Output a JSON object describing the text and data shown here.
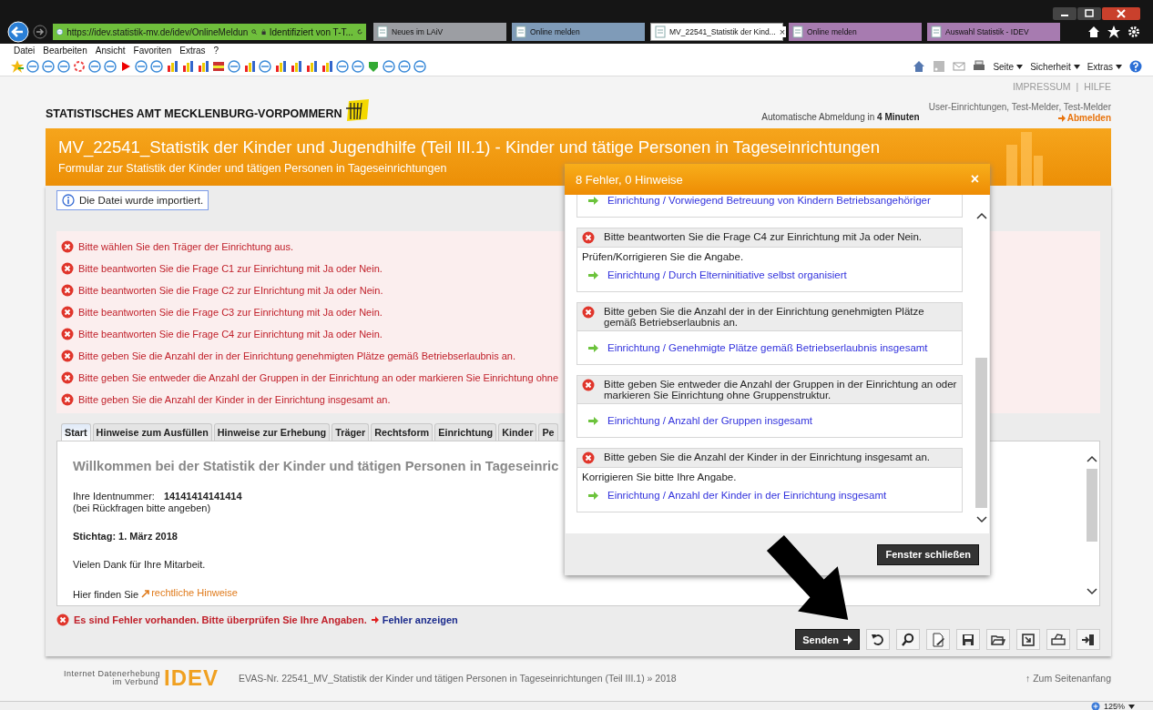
{
  "browser": {
    "url": "https://idev.statistik-mv.de/idev/OnlineMeldun",
    "identity": "Identifiziert von T-T...",
    "tabs": [
      {
        "label": "Neues im LAiV",
        "selected": false,
        "color": "#9c9ea3"
      },
      {
        "label": "Online melden",
        "selected": false,
        "color": "#7f9bb8"
      },
      {
        "label": "MV_22541_Statistik der Kind...",
        "selected": true,
        "color": "#ffffff"
      },
      {
        "label": "Online melden",
        "selected": false,
        "color": "#a77bb0"
      },
      {
        "label": "Auswahl Statistik - IDEV",
        "selected": false,
        "color": "#a77bb0"
      }
    ],
    "tab_close": "×",
    "menu": [
      "Datei",
      "Bearbeiten",
      "Ansicht",
      "Favoriten",
      "Extras",
      "?"
    ],
    "commands": [
      "Seite",
      "Sicherheit",
      "Extras"
    ],
    "zoom": "125%"
  },
  "header": {
    "links": [
      "IMPRESSUM",
      "HILFE"
    ],
    "link_separator": "|",
    "org": "STATISTISCHES AMT MECKLENBURG-VORPOMMERN",
    "session": "Automatische Abmeldung in **4 Minuten**",
    "user": "User-Einrichtungen, Test-Melder, Test-Melder",
    "logout": "Abmelden"
  },
  "banner": {
    "title": "MV_22541_Statistik der Kinder und Jugendhilfe (Teil III.1) - Kinder und tätige Personen in Tageseinrichtungen",
    "subtitle": "Formular zur Statistik der Kinder und tätigen Personen in Tageseinrichtungen"
  },
  "info": "Die Datei wurde importiert.",
  "errors": [
    "Bitte wählen Sie den Träger der Einrichtung aus.",
    "Bitte beantworten Sie die Frage C1 zur Einrichtung mit Ja oder Nein.",
    "Bitte beantworten Sie die Frage C2 zur EInrichtung mit Ja oder Nein.",
    "Bitte beantworten Sie die Frage C3 zur Einrichtung mit Ja oder Nein.",
    "Bitte beantworten Sie die Frage C4 zur Einrichtung mit Ja oder Nein.",
    "Bitte geben Sie die Anzahl der in der Einrichtung genehmigten Plätze gemäß Betriebserlaubnis an.",
    "Bitte geben Sie entweder die Anzahl der Gruppen in der Einrichtung an oder markieren Sie Einrichtung ohne",
    "Bitte geben Sie die Anzahl der Kinder in der Einrichtung insgesamt an."
  ],
  "form_tabs": [
    {
      "label": "Start",
      "selected": true
    },
    {
      "label": "Hinweise zum Ausfüllen",
      "selected": false
    },
    {
      "label": "Hinweise zur Erhebung",
      "selected": false
    },
    {
      "label": "Träger",
      "selected": false
    },
    {
      "label": "Rechtsform",
      "selected": false
    },
    {
      "label": "Einrichtung",
      "selected": false
    },
    {
      "label": "Kinder",
      "selected": false
    },
    {
      "label": "Pe",
      "selected": false
    }
  ],
  "content": {
    "heading": "Willkommen bei der Statistik der Kinder und tätigen Personen in Tageseinric",
    "id_label": "Ihre Identnummer:",
    "id_value": "14141414141414",
    "id_note": "(bei Rückfragen bitte angeben)",
    "deadline": "Stichtag: 1. März 2018",
    "thanks": "Vielen Dank für Ihre Mitarbeit.",
    "legal_prefix": "Hier finden Sie",
    "legal_link": "rechtliche Hinweise"
  },
  "error_summary": {
    "text": "Es sind Fehler vorhanden. Bitte überprüfen Sie Ihre Angaben.",
    "link": "Fehler anzeigen"
  },
  "toolbar": {
    "send": "Senden"
  },
  "dialog": {
    "title": "8 Fehler, 0 Hinweise",
    "close": "×",
    "items": [
      {
        "link": "Einrichtung / Vorwiegend Betreuung von Kindern Betriebsangehöriger"
      },
      {
        "message": "Bitte beantworten Sie die Frage C4 zur Einrichtung mit Ja oder Nein.",
        "hint": "Prüfen/Korrigieren Sie die Angabe.",
        "link": "Einrichtung / Durch Elterninitiative selbst organisiert"
      },
      {
        "message": "Bitte geben Sie die Anzahl der in der Einrichtung genehmigten Plätze gemäß Betriebserlaubnis an.",
        "link": "Einrichtung / Genehmigte Plätze gemäß Betriebserlaubnis insgesamt"
      },
      {
        "message": "Bitte geben Sie entweder die Anzahl der Gruppen in der Einrichtung an oder markieren Sie Einrichtung ohne Gruppenstruktur.",
        "link": "Einrichtung / Anzahl der Gruppen insgesamt"
      },
      {
        "message": "Bitte geben Sie die Anzahl der Kinder in der Einrichtung insgesamt an.",
        "hint": "Korrigieren Sie bitte Ihre Angabe.",
        "link": "Einrichtung / Anzahl der Kinder in der Einrichtung insgesamt"
      }
    ],
    "button": "Fenster schließen"
  },
  "footer": {
    "tag_line_1": "Internet Datenerhebung",
    "tag_line_2": "im Verbund",
    "brand": "IDEV",
    "text": "EVAS-Nr. 22541_MV_Statistik der Kinder und tätigen Personen in Tageseinrichtungen (Teil III.1) » 2018",
    "top": "↑ Zum Seitenanfang"
  }
}
